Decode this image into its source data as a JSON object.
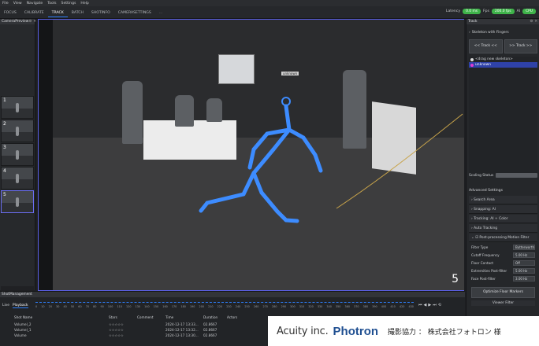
{
  "menu": [
    "File",
    "View",
    "Navigate",
    "Tools",
    "Settings",
    "Help"
  ],
  "tabs": [
    "FOCUS",
    "CALIBRATE",
    "TRACK",
    "BATCH",
    "SHOTINFO",
    "CAMERASETTINGS",
    "..."
  ],
  "status": {
    "latency_label": "Latency",
    "latency_value": "0.0 ms",
    "fps_label": "Fps",
    "fps_value": "200.0 fps",
    "ai_label": "AI",
    "ai_value": "CPU"
  },
  "camera_preview": {
    "title": "CameraPreview",
    "thumbs": [
      "1",
      "2",
      "3",
      "4",
      "5"
    ]
  },
  "viewer": {
    "frame_number": "5",
    "person_tag": "unknown"
  },
  "track": {
    "title": "Track",
    "section": "Skeleton with Fingers",
    "btn_track_back": "<< Track <<",
    "btn_track_fwd": ">> Track >>",
    "skeletons": [
      {
        "label": "<drag new skeleton>"
      },
      {
        "label": "unknown"
      }
    ],
    "scaling_label": "Scaling Status",
    "advanced_title": "Advanced Settings",
    "sections": [
      "Search Area",
      "Snapping: AI",
      "Tracking: AI + Color",
      "Auto Tracking",
      "Post-processing Motion Filter"
    ],
    "filter": [
      {
        "label": "Filter Type",
        "value": "Butterworth"
      },
      {
        "label": "Cutoff Frequency",
        "value": "5.00 Hz"
      },
      {
        "label": "Floor Contact",
        "value": "Off"
      },
      {
        "label": "Extremities Post-filter",
        "value": "5.00 Hz"
      },
      {
        "label": "Face Post-filter",
        "value": "3.00 Hz"
      }
    ],
    "optimize_btn": "Optimize Floor Markers",
    "viewer_filter": "Viewer Filter"
  },
  "shots": {
    "title": "ShotManagement",
    "tab_live": "Live",
    "tab_playback": "Playback",
    "columns": [
      "Shot Name",
      "Stars",
      "Comment",
      "Time",
      "Duration",
      "Actors"
    ],
    "rows": [
      {
        "name": "Volumel_2",
        "stars": "☆☆☆☆☆",
        "comment": "",
        "time": "2024-12-17 13:33...",
        "duration": "02.8667",
        "actors": ""
      },
      {
        "name": "Volumel_1",
        "stars": "☆☆☆☆☆",
        "comment": "",
        "time": "2024-12-17 13:32...",
        "duration": "02.8667",
        "actors": ""
      },
      {
        "name": "Volume",
        "stars": "☆☆☆☆☆",
        "comment": "",
        "time": "2024-12-17 13:30...",
        "duration": "02.8667",
        "actors": ""
      }
    ],
    "timeline_ticks": [
      "0",
      "10",
      "20",
      "30",
      "40",
      "50",
      "60",
      "70",
      "80",
      "90",
      "100",
      "110",
      "120",
      "130",
      "140",
      "150",
      "160",
      "170",
      "180",
      "190",
      "200",
      "210",
      "220",
      "230",
      "240",
      "250",
      "260",
      "270",
      "280",
      "290",
      "300",
      "310",
      "320",
      "330",
      "340",
      "350",
      "360",
      "370",
      "380",
      "390",
      "400",
      "410",
      "420",
      "430"
    ]
  },
  "banner": {
    "acuity": "Acuity inc.",
    "photron": "Photron",
    "credit": "撮影協力 ： 株式会社フォトロン 様"
  }
}
